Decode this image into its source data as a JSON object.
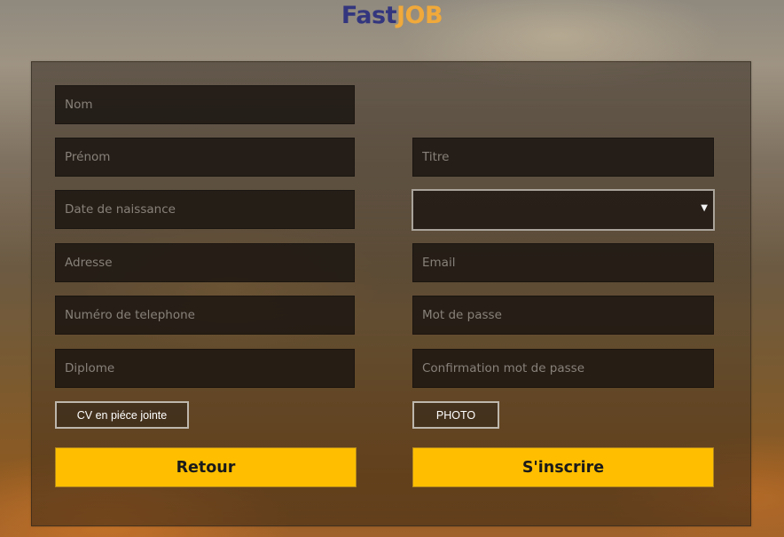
{
  "brand": {
    "part1": "Fast",
    "part2": "JOB",
    "color1": "#33367e",
    "color2": "#f0a93a"
  },
  "form": {
    "left_fields": [
      {
        "name": "nom",
        "placeholder": "Nom"
      },
      {
        "name": "prenom",
        "placeholder": "Prénom"
      },
      {
        "name": "date-naissance",
        "placeholder": "Date de naissance"
      },
      {
        "name": "adresse",
        "placeholder": "Adresse"
      },
      {
        "name": "telephone",
        "placeholder": "Numéro de telephone"
      },
      {
        "name": "diplome",
        "placeholder": "Diplome"
      }
    ],
    "right_fields": [
      {
        "name": "titre",
        "placeholder": "Titre"
      },
      {
        "name": "email",
        "placeholder": "Email"
      },
      {
        "name": "mot-de-passe",
        "placeholder": "Mot de passe"
      },
      {
        "name": "confirmation",
        "placeholder": "Confirmation mot de passe"
      }
    ],
    "select": {
      "value": "",
      "arrow_icon": "caret-down-icon"
    },
    "cv_button": "CV en piéce jointe",
    "photo_button": "PHOTO",
    "back_button": "Retour",
    "submit_button": "S'inscrire",
    "button_color": "#ffbf00"
  }
}
